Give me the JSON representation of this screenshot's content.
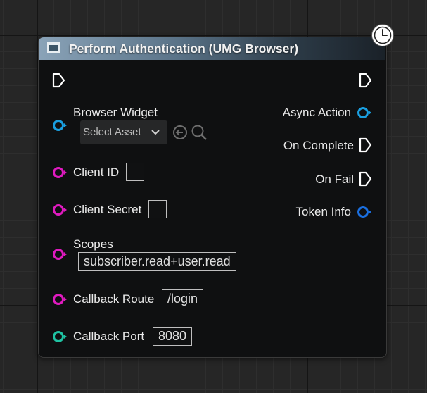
{
  "node": {
    "title": "Perform Authentication (UMG Browser)",
    "icons": {
      "header": "window-icon",
      "latent": "clock-icon"
    }
  },
  "inputs": {
    "browser_widget": {
      "label": "Browser Widget",
      "select_text": "Select Asset",
      "pin_color": "#1a9fe0"
    },
    "client_id": {
      "label": "Client ID",
      "value": "",
      "pin_color": "#e01ac0"
    },
    "client_secret": {
      "label": "Client Secret",
      "value": "",
      "pin_color": "#e01ac0"
    },
    "scopes": {
      "label": "Scopes",
      "value": "subscriber.read+user.read",
      "pin_color": "#e01ac0"
    },
    "callback_route": {
      "label": "Callback Route",
      "value": "/login",
      "pin_color": "#e01ac0"
    },
    "callback_port": {
      "label": "Callback Port",
      "value": "8080",
      "pin_color": "#1fc3a3"
    }
  },
  "outputs": {
    "async_action": {
      "label": "Async Action",
      "pin_color": "#1a9fe0"
    },
    "on_complete": {
      "label": "On Complete"
    },
    "on_fail": {
      "label": "On Fail"
    },
    "token_info": {
      "label": "Token Info",
      "pin_color": "#1a6fe0"
    }
  }
}
